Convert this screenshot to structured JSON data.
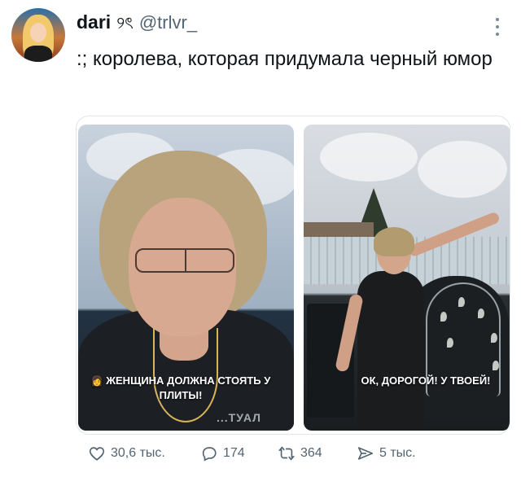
{
  "author": {
    "display_name": "dari",
    "name_emoji": "୨ৎ",
    "handle": "@trlvr_"
  },
  "tweet": {
    "text": ":; королева, которая придумала черный юмор"
  },
  "media": {
    "left_caption_emoji": "👩",
    "left_caption": "ЖЕНЩИНА ДОЛЖНА СТОЯТЬ У ПЛИТЫ!",
    "left_shirt_print": "...ТУАЛ",
    "right_caption": "ОК, ДОРОГОЙ! У ТВОЕЙ!"
  },
  "actions": {
    "likes": "30,6 тыс.",
    "replies": "174",
    "retweets": "364",
    "shares": "5 тыс."
  },
  "colors": {
    "text": "#0f1419",
    "secondary": "#536471",
    "border": "#e1e6ea"
  }
}
